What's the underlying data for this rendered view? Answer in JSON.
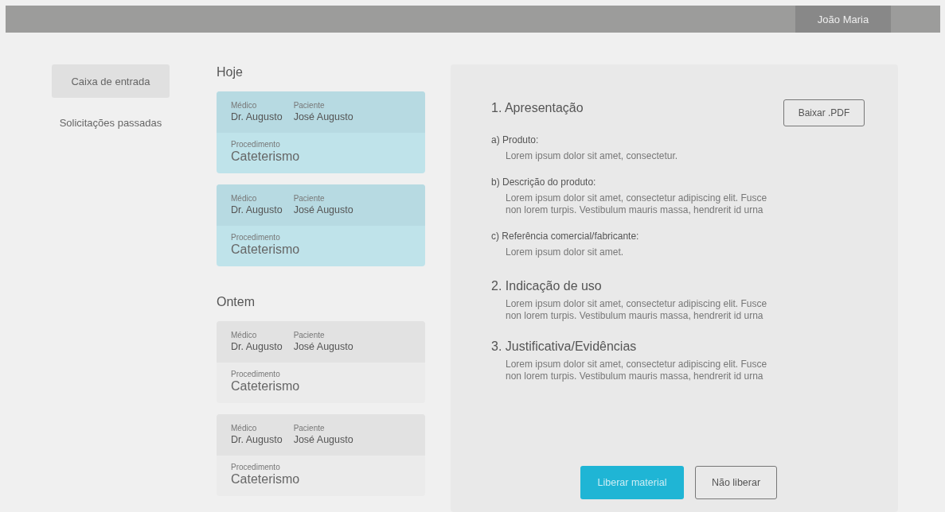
{
  "top_bar": {
    "user": "João Maria"
  },
  "sidebar": {
    "items": [
      {
        "label": "Caixa de entrada",
        "selected": true
      },
      {
        "label": "Solicitações passadas",
        "selected": false
      }
    ]
  },
  "request_groups": [
    {
      "heading": "Hoje",
      "cards": [
        {
          "selected": true,
          "doctor_label": "Médico",
          "doctor": "Dr. Augusto",
          "patient_label": "Paciente",
          "patient": "José Augusto",
          "procedure_label": "Procedimento",
          "procedure": "Cateterismo"
        },
        {
          "selected": true,
          "doctor_label": "Médico",
          "doctor": "Dr. Augusto",
          "patient_label": "Paciente",
          "patient": "José Augusto",
          "procedure_label": "Procedimento",
          "procedure": "Cateterismo"
        }
      ]
    },
    {
      "heading": "Ontem",
      "cards": [
        {
          "selected": false,
          "doctor_label": "Médico",
          "doctor": "Dr. Augusto",
          "patient_label": "Paciente",
          "patient": "José Augusto",
          "procedure_label": "Procedimento",
          "procedure": "Cateterismo"
        },
        {
          "selected": false,
          "doctor_label": "Médico",
          "doctor": "Dr. Augusto",
          "patient_label": "Paciente",
          "patient": "José Augusto",
          "procedure_label": "Procedimento",
          "procedure": "Cateterismo"
        }
      ]
    }
  ],
  "detail": {
    "download_button": "Baixar .PDF",
    "sections": [
      {
        "title": "1. Apresentação",
        "subsections": [
          {
            "label": "a) Produto:",
            "text": "Lorem ipsum dolor sit amet, consectetur."
          },
          {
            "label": "b) Descrição do produto:",
            "text": "Lorem ipsum dolor sit amet, consectetur adipiscing elit. Fusce non lorem turpis. Vestibulum mauris massa, hendrerit id urna"
          },
          {
            "label": "c) Referência comercial/fabricante:",
            "text": "Lorem ipsum dolor sit amet."
          }
        ]
      },
      {
        "title": "2. Indicação de uso",
        "text": "Lorem ipsum dolor sit amet, consectetur adipiscing elit. Fusce non lorem turpis. Vestibulum mauris massa, hendrerit id urna"
      },
      {
        "title": "3. Justificativa/Evidências",
        "text": "Lorem ipsum dolor sit amet, consectetur adipiscing elit. Fusce non lorem turpis. Vestibulum mauris massa, hendrerit id urna"
      }
    ],
    "actions": [
      {
        "label": "Liberar material",
        "kind": "primary"
      },
      {
        "label": "Não liberar",
        "kind": "secondary"
      }
    ]
  }
}
